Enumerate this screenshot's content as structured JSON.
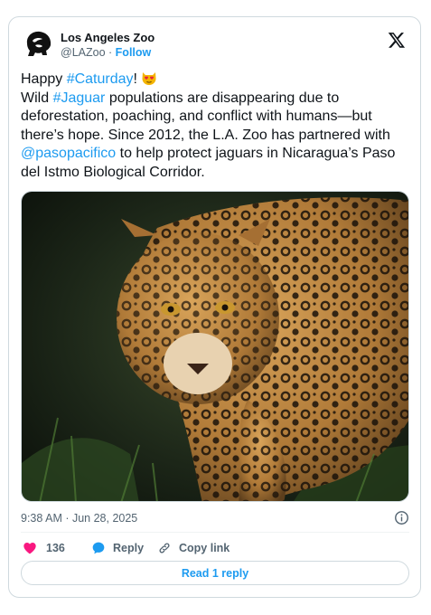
{
  "author": {
    "display_name": "Los Angeles Zoo",
    "handle": "@LAZoo",
    "separator": "·",
    "follow_label": "Follow"
  },
  "tweet": {
    "line1_prefix": "Happy ",
    "line1_hashtag": "#Caturday",
    "line1_suffix": "!",
    "emoji": "heart-eyes-cat-emoji",
    "p2_text_a": "Wild ",
    "p2_hashtag": "#Jaguar",
    "p2_text_b": " populations are disappearing due to deforestation, poaching, and conflict with humans—but there’s hope. Since 2012, the L.A. Zoo has partnered with ",
    "p2_mention": "@pasopacifico",
    "p2_text_c": " to help protect jaguars in Nicaragua’s Paso del Istmo Biological Corridor."
  },
  "media": {
    "subject": "jaguar photo"
  },
  "meta": {
    "timestamp": "9:38 AM · Jun 28, 2025"
  },
  "actions": {
    "like_count": "136",
    "reply_label": "Reply",
    "copy_link_label": "Copy link"
  },
  "footer": {
    "read_reply_label": "Read 1 reply"
  },
  "colors": {
    "link": "#1d9bf0",
    "like": "#f91880",
    "text": "#0f1419",
    "secondary": "#536471"
  }
}
